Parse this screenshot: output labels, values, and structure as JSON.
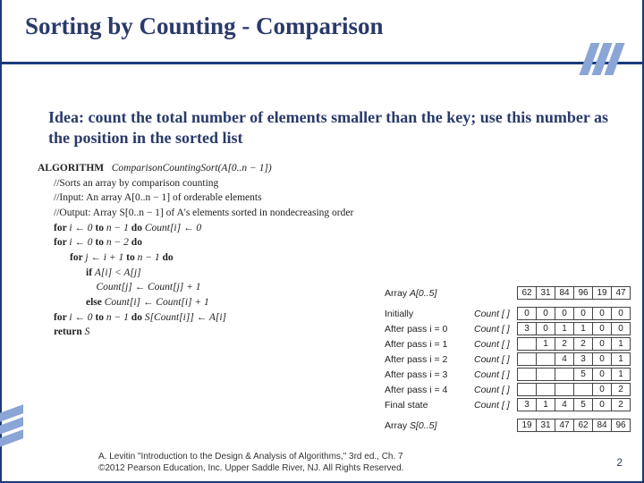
{
  "title": "Sorting by Counting - Comparison",
  "idea": "Idea: count the total number of elements smaller than the key; use this number as the position in the sorted list",
  "algorithm": {
    "header_kw": "ALGORITHM",
    "header_name": "ComparisonCountingSort(A[0..n − 1])",
    "comment1": "//Sorts an array by comparison counting",
    "comment2": "//Input: An array A[0..n − 1] of orderable elements",
    "comment3": "//Output: Array S[0..n − 1] of A's elements sorted in nondecreasing order",
    "line1a": "for ",
    "line1b": "i ← 0 ",
    "line1c": "to ",
    "line1d": "n − 1 ",
    "line1e": "do ",
    "line1f": "Count[i] ← 0",
    "line2a": "for ",
    "line2b": "i ← 0 ",
    "line2c": "to ",
    "line2d": "n − 2 ",
    "line2e": "do",
    "line3a": "for ",
    "line3b": "j ← i + 1 ",
    "line3c": "to ",
    "line3d": "n − 1 ",
    "line3e": "do",
    "line4a": "if ",
    "line4b": "A[i] < A[j]",
    "line5": "Count[j] ← Count[j] + 1",
    "line6a": "else ",
    "line6b": "Count[i] ← Count[i] + 1",
    "line7a": "for ",
    "line7b": "i ← 0 ",
    "line7c": "to ",
    "line7d": "n − 1 ",
    "line7e": "do ",
    "line7f": "S[Count[i]] ← A[i]",
    "line8a": "return ",
    "line8b": "S"
  },
  "trace": {
    "array_label": "Array ",
    "array_A": "A[0..5]",
    "array_S": "S[0..5]",
    "A_values": [
      "62",
      "31",
      "84",
      "96",
      "19",
      "47"
    ],
    "count_word": "Count",
    "brackets": "[ ]",
    "rows": [
      {
        "label": "Initially",
        "vals": [
          "0",
          "0",
          "0",
          "0",
          "0",
          "0"
        ]
      },
      {
        "label": "After pass i  = 0",
        "vals": [
          "3",
          "0",
          "1",
          "1",
          "0",
          "0"
        ]
      },
      {
        "label": "After pass i  = 1",
        "vals": [
          "",
          "1",
          "2",
          "2",
          "0",
          "1"
        ]
      },
      {
        "label": "After pass i  = 2",
        "vals": [
          "",
          "",
          "4",
          "3",
          "0",
          "1"
        ]
      },
      {
        "label": "After pass i  = 3",
        "vals": [
          "",
          "",
          "",
          "5",
          "0",
          "1"
        ]
      },
      {
        "label": "After pass i  = 4",
        "vals": [
          "",
          "",
          "",
          "",
          "0",
          "2"
        ]
      },
      {
        "label": "Final state",
        "vals": [
          "3",
          "1",
          "4",
          "5",
          "0",
          "2"
        ]
      }
    ],
    "S_values": [
      "19",
      "31",
      "47",
      "62",
      "84",
      "96"
    ]
  },
  "footer": {
    "line1": "A. Levitin \"Introduction to the Design & Analysis of Algorithms,\" 3rd ed., Ch. 7",
    "line2": "©2012 Pearson Education, Inc. Upper Saddle River, NJ. All Rights Reserved."
  },
  "page": "2"
}
